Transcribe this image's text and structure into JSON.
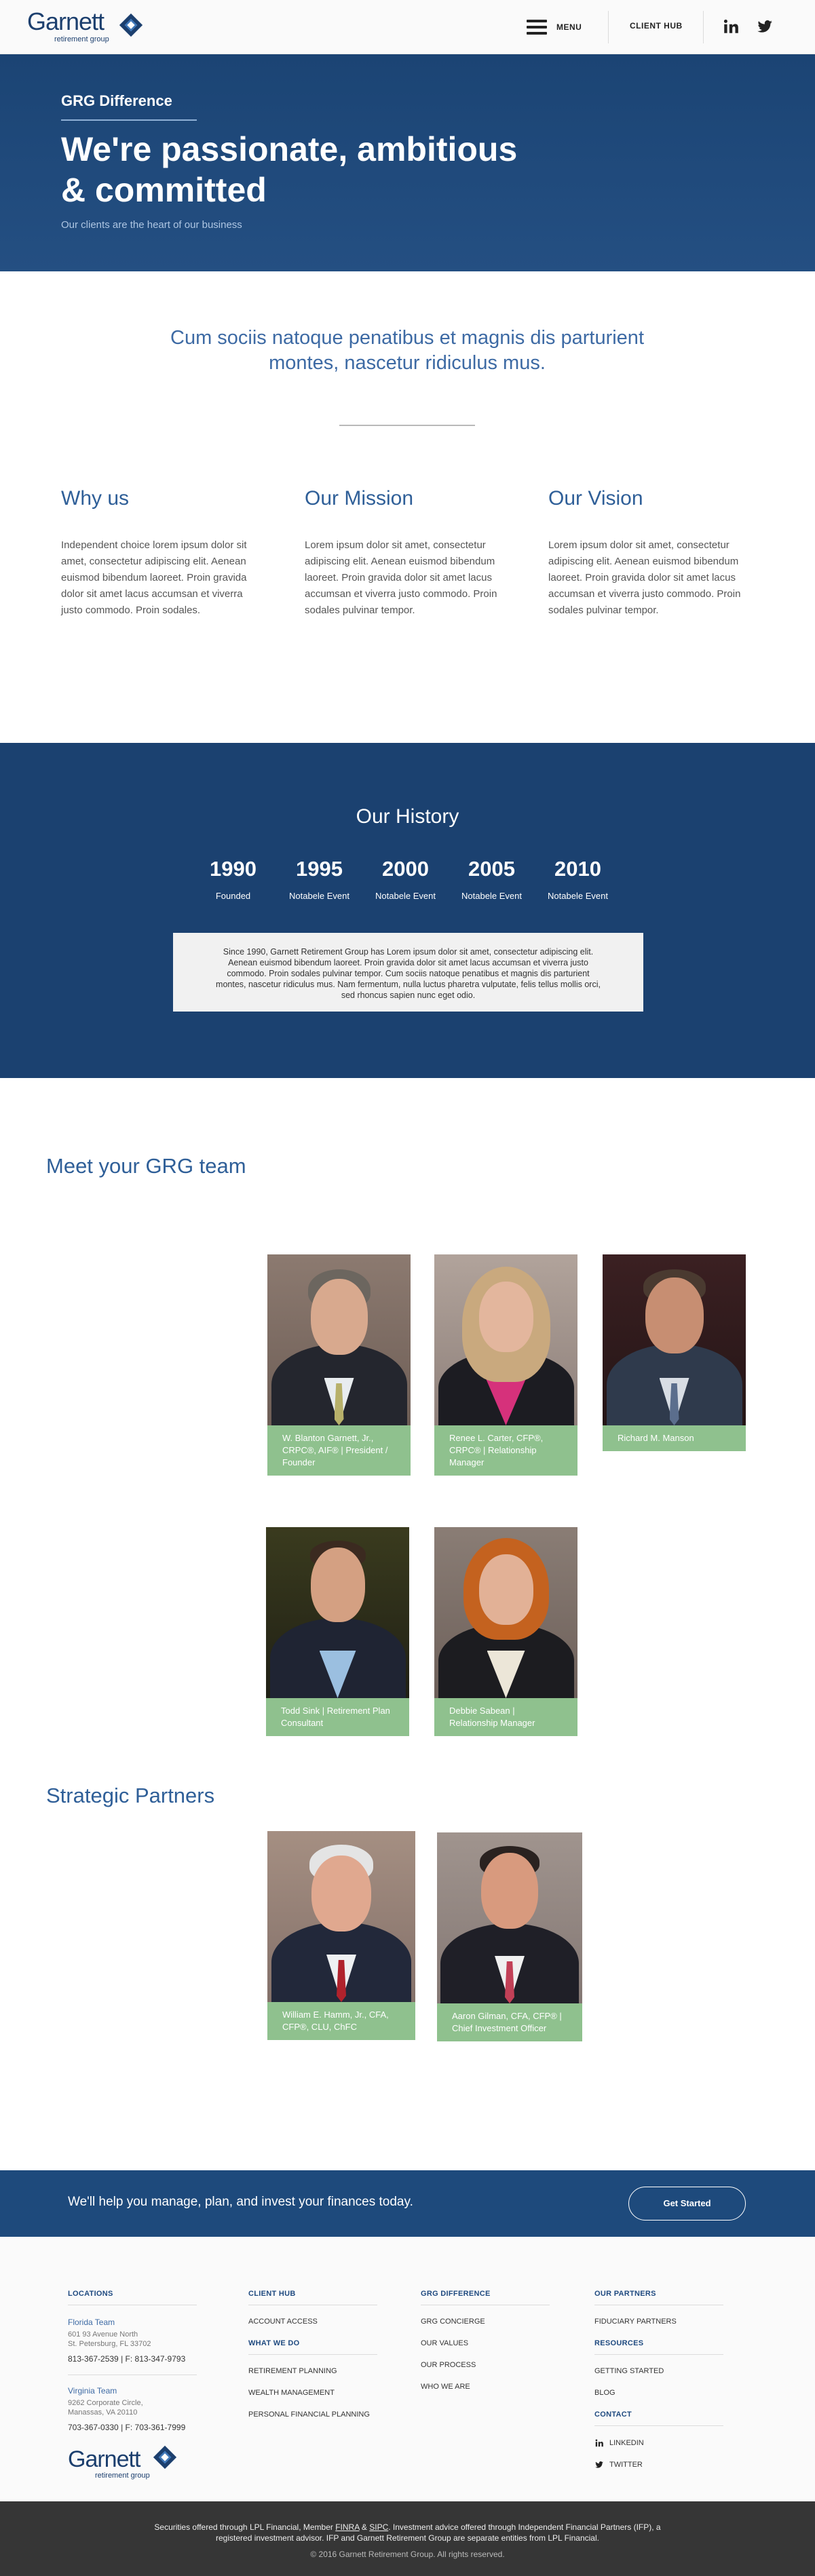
{
  "header": {
    "logo_text": "Garnett",
    "logo_subtext": "retirement group",
    "menu_label": "MENU",
    "client_hub_label": "CLIENT HUB",
    "social_icons": [
      "linkedin-icon",
      "twitter-icon"
    ]
  },
  "hero": {
    "eyebrow": "GRG Difference",
    "title": "We're passionate, ambitious & committed",
    "subtitle": "Our clients are the heart of our business"
  },
  "intro": {
    "quote": "Cum sociis natoque penatibus et magnis dis parturient montes, nascetur ridiculus mus.",
    "columns": [
      {
        "heading": "Why us",
        "text": "Independent choice lorem ipsum dolor sit amet, consectetur adipiscing elit. Aenean euismod bibendum laoreet. Proin gravida dolor sit amet lacus accumsan et viverra justo commodo. Proin sodales."
      },
      {
        "heading": "Our Mission",
        "text": "Lorem ipsum dolor sit amet, consectetur adipiscing elit. Aenean euismod bibendum laoreet. Proin gravida dolor sit amet lacus accumsan et viverra justo commodo. Proin sodales pulvinar tempor."
      },
      {
        "heading": "Our Vision",
        "text": "Lorem ipsum dolor sit amet, consectetur adipiscing elit. Aenean euismod bibendum laoreet. Proin gravida dolor sit amet lacus accumsan et viverra justo commodo. Proin sodales pulvinar tempor."
      }
    ]
  },
  "history": {
    "title": "Our History",
    "years": [
      {
        "year": "1990",
        "label": "Founded"
      },
      {
        "year": "1995",
        "label": "Notabele Event"
      },
      {
        "year": "2000",
        "label": "Notabele Event"
      },
      {
        "year": "2005",
        "label": "Notabele Event"
      },
      {
        "year": "2010",
        "label": "Notabele Event"
      }
    ],
    "description": "Since 1990, Garnett Retirement Group has Lorem ipsum dolor sit amet, consectetur adipiscing elit. Aenean euismod bibendum laoreet. Proin gravida dolor sit amet lacus accumsan et viverra justo commodo. Proin sodales pulvinar tempor. Cum sociis natoque penatibus et magnis dis parturient montes, nascetur ridiculus mus. Nam fermentum, nulla luctus pharetra vulputate, felis tellus mollis orci, sed rhoncus sapien nunc eget odio."
  },
  "team": {
    "title": "Meet your GRG team",
    "members": [
      {
        "name": "W. Blanton Garnett, Jr., CRPC®, AIF® | President / Founder"
      },
      {
        "name": "Renee L. Carter, CFP®, CRPC® | Relationship Manager"
      },
      {
        "name": "Richard M. Manson"
      },
      {
        "name": "Todd Sink | Retirement Plan Consultant"
      },
      {
        "name": "Debbie Sabean | Relationship Manager"
      }
    ]
  },
  "partners": {
    "title": "Strategic Partners",
    "members": [
      {
        "name": "William E. Hamm, Jr., CFA, CFP®, CLU, ChFC"
      },
      {
        "name": "Aaron Gilman, CFA, CFP® | Chief Investment Officer"
      }
    ]
  },
  "cta": {
    "text": "We'll help you manage, plan, and invest your finances today.",
    "button": "Get Started"
  },
  "footer": {
    "locations": {
      "heading": "LOCATIONS",
      "florida": {
        "name": "Florida Team",
        "address1": "601 93 Avenue North",
        "address2": "St. Petersburg, FL 33702",
        "phone": "813-367-2539 | F: 813-347-9793"
      },
      "virginia": {
        "name": "Virginia Team",
        "address1": "9262 Corporate Circle,",
        "address2": "Manassas, VA 20110",
        "phone": "703-367-0330 | F: 703-361-7999"
      }
    },
    "client_hub": {
      "heading": "CLIENT HUB",
      "links": [
        "ACCOUNT ACCESS"
      ]
    },
    "what_we_do": {
      "heading": "WHAT WE DO",
      "links": [
        "RETIREMENT PLANNING",
        "WEALTH MANAGEMENT",
        "PERSONAL FINANCIAL PLANNING"
      ]
    },
    "grg_difference": {
      "heading": "GRG DIFFERENCE",
      "links": [
        "GRG CONCIERGE",
        "OUR VALUES",
        "OUR PROCESS",
        "WHO WE ARE"
      ]
    },
    "our_partners": {
      "heading": "OUR PARTNERS",
      "links": [
        "FIDUCIARY PARTNERS"
      ]
    },
    "resources": {
      "heading": "RESOURCES",
      "links": [
        "GETTING STARTED",
        "BLOG"
      ]
    },
    "contact": {
      "heading": "CONTACT",
      "links": [
        "LINKEDIN",
        "TWITTER"
      ]
    },
    "logo_text": "Garnett",
    "logo_subtext": "retirement group"
  },
  "legal": {
    "line1_a": "Securities offered through LPL Financial, Member ",
    "finra": "FINRA",
    "amp": " & ",
    "sipc": "SIPC",
    "line1_b": ". Investment advice offered through Independent Financial Partners (IFP), a",
    "line2": "registered investment advisor.  IFP and Garnett Retirement Group are separate entities from LPL Financial.",
    "copyright": "© 2016 Garnett Retirement Group. All rights reserved."
  },
  "colors": {
    "brand_blue": "#1c3f6e",
    "accent_blue": "#2f5f98",
    "caption_green": "#8fc18e",
    "footer_dark": "#363636"
  }
}
